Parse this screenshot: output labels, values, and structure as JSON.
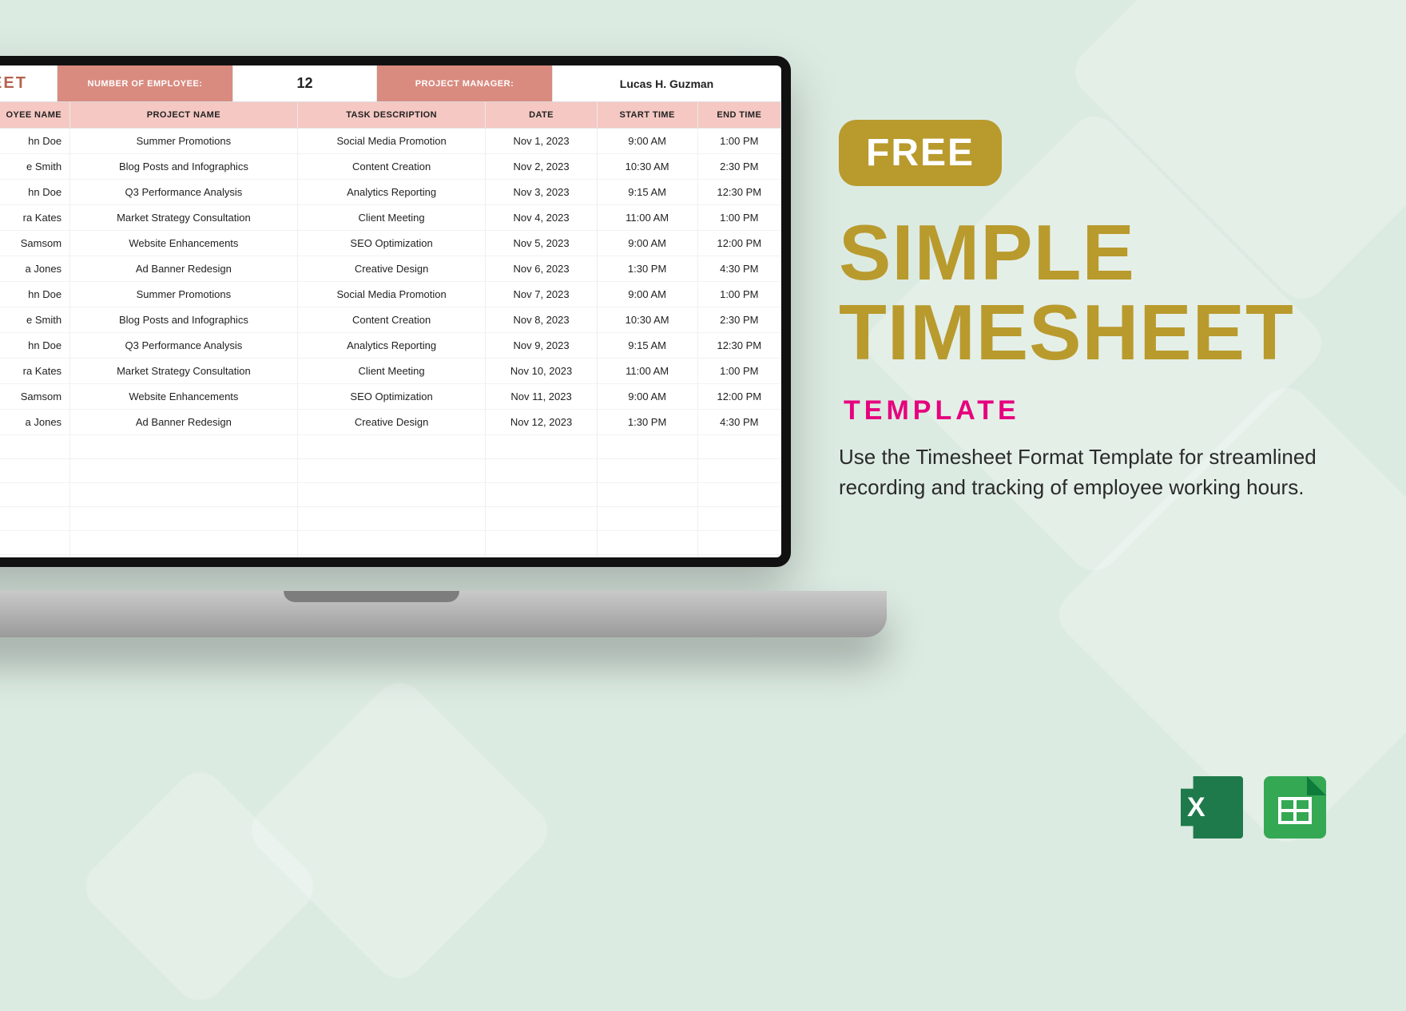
{
  "promo": {
    "badge": "FREE",
    "title_line1": "SIMPLE",
    "title_line2": "TIMESHEET",
    "template_word": "TEMPLATE",
    "description": "Use the Timesheet Format Template for streamlined recording and tracking of employee working hours."
  },
  "file_icons": {
    "excel": "excel-icon",
    "sheets": "google-sheets-icon"
  },
  "sheet": {
    "title_fragment": "EET",
    "num_employee_label": "NUMBER OF EMPLOYEE:",
    "num_employee_value": "12",
    "project_manager_label": "PROJECT MANAGER:",
    "project_manager_value": "Lucas H. Guzman",
    "columns": [
      "OYEE NAME",
      "PROJECT NAME",
      "TASK DESCRIPTION",
      "DATE",
      "START TIME",
      "END TIME"
    ],
    "rows": [
      {
        "emp": "hn Doe",
        "proj": "Summer Promotions",
        "task": "Social Media Promotion",
        "date": "Nov 1, 2023",
        "start": "9:00 AM",
        "end": "1:00 PM"
      },
      {
        "emp": "e Smith",
        "proj": "Blog Posts and Infographics",
        "task": "Content Creation",
        "date": "Nov 2, 2023",
        "start": "10:30 AM",
        "end": "2:30 PM"
      },
      {
        "emp": "hn Doe",
        "proj": "Q3 Performance Analysis",
        "task": "Analytics Reporting",
        "date": "Nov 3, 2023",
        "start": "9:15 AM",
        "end": "12:30 PM"
      },
      {
        "emp": "ra Kates",
        "proj": "Market Strategy Consultation",
        "task": "Client Meeting",
        "date": "Nov 4, 2023",
        "start": "11:00 AM",
        "end": "1:00 PM"
      },
      {
        "emp": "Samsom",
        "proj": "Website Enhancements",
        "task": "SEO Optimization",
        "date": "Nov 5, 2023",
        "start": "9:00 AM",
        "end": "12:00 PM"
      },
      {
        "emp": "a Jones",
        "proj": "Ad Banner Redesign",
        "task": "Creative Design",
        "date": "Nov 6, 2023",
        "start": "1:30 PM",
        "end": "4:30 PM"
      },
      {
        "emp": "hn Doe",
        "proj": "Summer Promotions",
        "task": "Social Media Promotion",
        "date": "Nov 7, 2023",
        "start": "9:00 AM",
        "end": "1:00 PM"
      },
      {
        "emp": "e Smith",
        "proj": "Blog Posts and Infographics",
        "task": "Content Creation",
        "date": "Nov 8, 2023",
        "start": "10:30 AM",
        "end": "2:30 PM"
      },
      {
        "emp": "hn Doe",
        "proj": "Q3 Performance Analysis",
        "task": "Analytics Reporting",
        "date": "Nov 9, 2023",
        "start": "9:15 AM",
        "end": "12:30 PM"
      },
      {
        "emp": "ra Kates",
        "proj": "Market Strategy Consultation",
        "task": "Client Meeting",
        "date": "Nov 10, 2023",
        "start": "11:00 AM",
        "end": "1:00 PM"
      },
      {
        "emp": "Samsom",
        "proj": "Website Enhancements",
        "task": "SEO Optimization",
        "date": "Nov 11, 2023",
        "start": "9:00 AM",
        "end": "12:00 PM"
      },
      {
        "emp": "a Jones",
        "proj": "Ad Banner Redesign",
        "task": "Creative Design",
        "date": "Nov 12, 2023",
        "start": "1:30 PM",
        "end": "4:30 PM"
      }
    ],
    "empty_rows": 6
  }
}
